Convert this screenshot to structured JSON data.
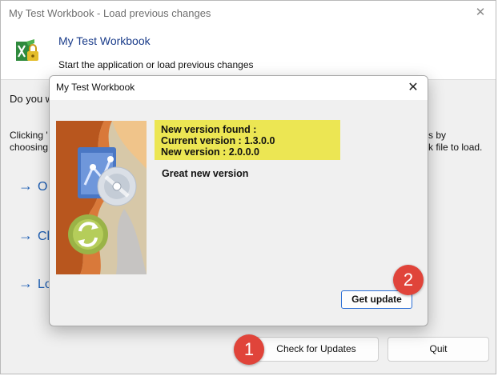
{
  "outer_window": {
    "title": "My Test Workbook - Load previous changes",
    "close_glyph": "✕",
    "header": {
      "title": "My Test Workbook",
      "subtitle": "Start the application or load previous changes",
      "icon": "excel-lock-icon"
    },
    "question_partial": "Do you w",
    "clicking_line1_partial": "Clicking '",
    "clicking_line2_partial": "choosing",
    "right_line1_partial": "s by",
    "right_line2_partial": "k file to load.",
    "options": [
      {
        "arrow": "→",
        "label_partial": "O"
      },
      {
        "arrow": "→",
        "label_partial": "Cl"
      },
      {
        "arrow": "→",
        "label_partial": "Lo"
      }
    ],
    "buttons": {
      "check_updates": "Check for Updates",
      "quit": "Quit"
    }
  },
  "dialog": {
    "title": "My Test Workbook",
    "close_glyph": "✕",
    "image": "update-illustration",
    "version_found": "New version found :",
    "current_version": "Current version : 1.3.0.0",
    "new_version": "New version : 2.0.0.0",
    "message": "Great new version",
    "get_update_label": "Get update"
  },
  "badges": {
    "step1": "1",
    "step2": "2"
  },
  "colors": {
    "badge": "#e0443a",
    "version_highlight": "#ece653",
    "link_blue": "#1e5fb4",
    "focus_border": "#2b6fd6"
  }
}
